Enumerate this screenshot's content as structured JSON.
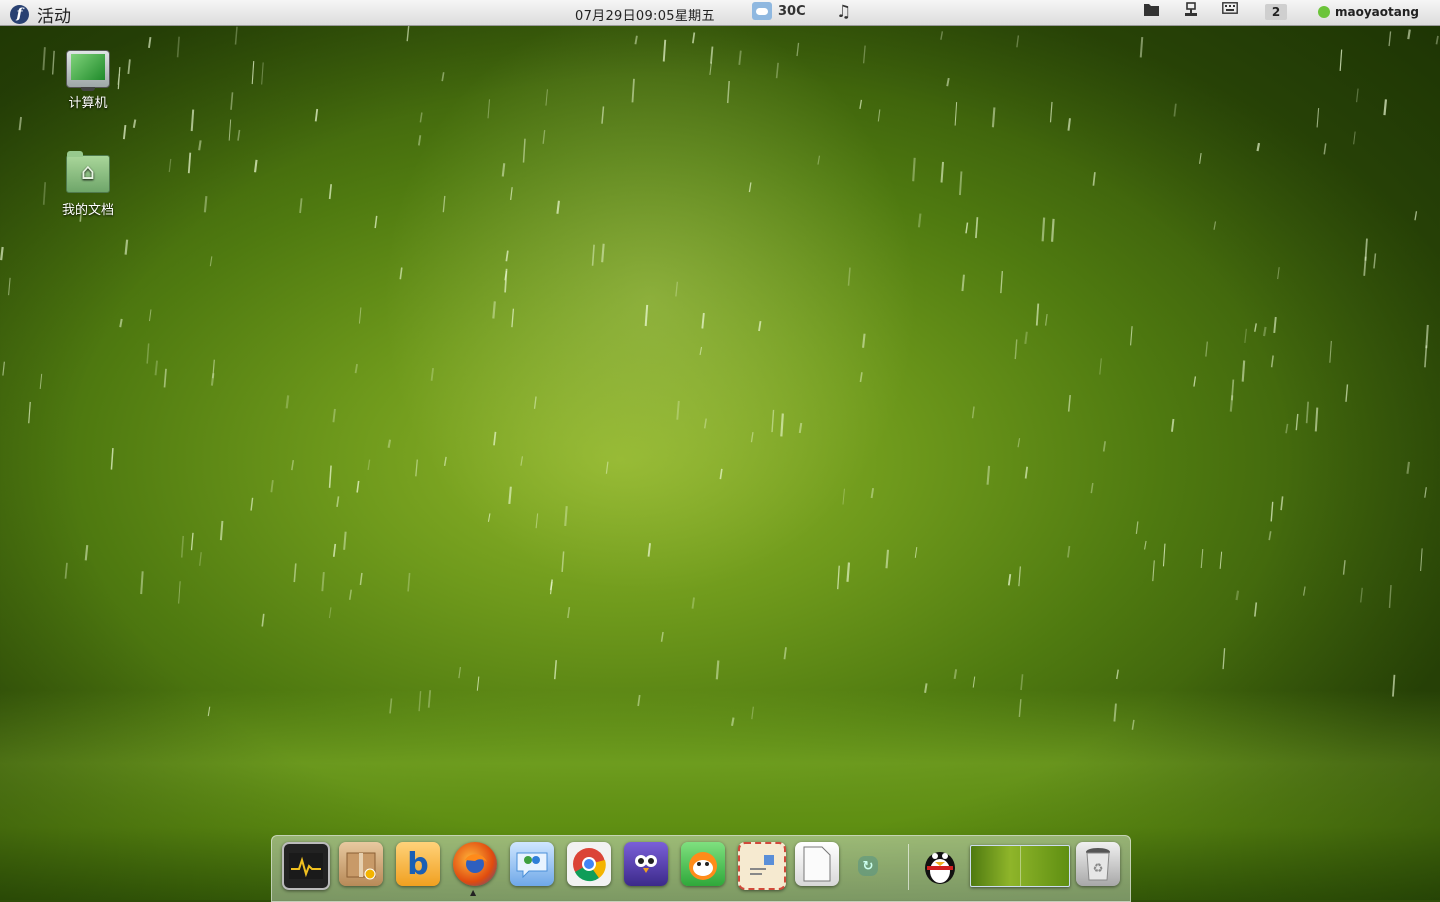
{
  "top_panel": {
    "activities_icon": "fedora-logo",
    "activities_label": "活动",
    "clock": "07月29日09:05星期五",
    "weather": {
      "icon": "partly-cloudy-icon",
      "temperature": "30C"
    },
    "music_icon": "music-note-icon",
    "tray_icons": [
      "folder-icon",
      "network-icon",
      "keyboard-icon"
    ],
    "workspace_number": "2",
    "user": {
      "status_color": "#6cc43a",
      "name": "maoyaotang"
    }
  },
  "desktop": {
    "icons": [
      {
        "label": "计算机",
        "icon": "computer-icon"
      },
      {
        "label": "我的文档",
        "icon": "home-folder-icon"
      }
    ]
  },
  "dock": {
    "items": [
      {
        "name": "system-monitor",
        "icon": "system-monitor-icon"
      },
      {
        "name": "package-manager",
        "icon": "package-icon"
      },
      {
        "name": "b-app",
        "icon": "b-letter-icon",
        "glyph": "b"
      },
      {
        "name": "firefox",
        "icon": "firefox-icon",
        "running": true
      },
      {
        "name": "messenger",
        "icon": "messenger-icon"
      },
      {
        "name": "chrome",
        "icon": "chrome-icon"
      },
      {
        "name": "bird-app",
        "icon": "bird-icon"
      },
      {
        "name": "pps-player",
        "icon": "pps-icon"
      },
      {
        "name": "mail",
        "icon": "mail-stamp-icon"
      },
      {
        "name": "text-document",
        "icon": "document-icon"
      },
      {
        "name": "small-app",
        "icon": "refresh-icon"
      },
      {
        "name": "qq",
        "icon": "qq-penguin-icon"
      },
      {
        "name": "workspace-switcher",
        "icon": "workspace-thumbnail-icon"
      },
      {
        "name": "trash",
        "icon": "trash-icon"
      }
    ]
  },
  "colors": {
    "wallpaper_green": "#6f9a1c",
    "panel_bg": "#e8e8e8"
  }
}
